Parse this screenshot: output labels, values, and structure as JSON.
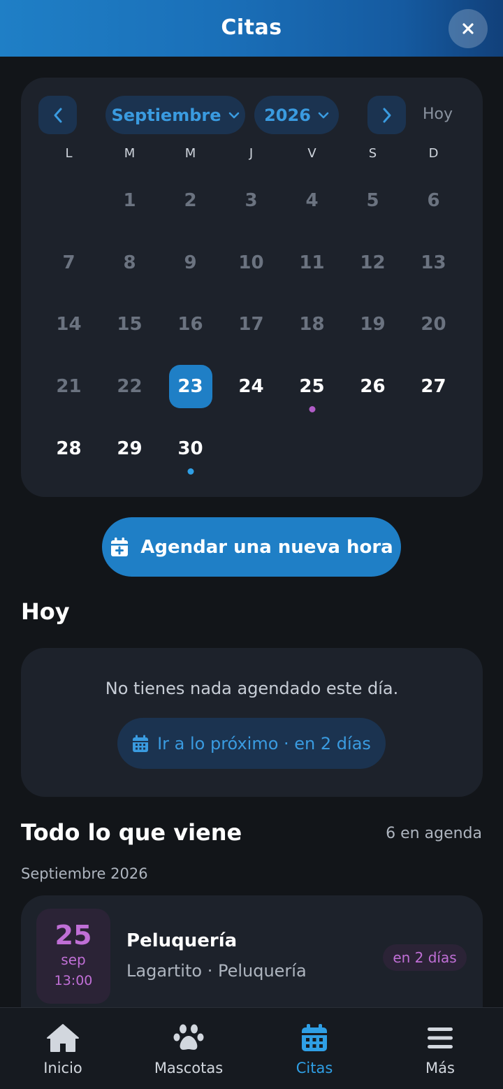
{
  "header": {
    "title": "Citas",
    "close_icon": "close-icon"
  },
  "calendar": {
    "month": "Septiembre",
    "year": "2026",
    "today_label": "Hoy",
    "weekdays": [
      "L",
      "M",
      "M",
      "J",
      "V",
      "S",
      "D"
    ],
    "selected_day": 23,
    "days": [
      {
        "n": "1",
        "state": "past"
      },
      {
        "n": "2",
        "state": "past"
      },
      {
        "n": "3",
        "state": "past"
      },
      {
        "n": "4",
        "state": "past"
      },
      {
        "n": "5",
        "state": "past"
      },
      {
        "n": "6",
        "state": "past"
      },
      {
        "n": "7",
        "state": "past"
      },
      {
        "n": "8",
        "state": "past"
      },
      {
        "n": "9",
        "state": "past"
      },
      {
        "n": "10",
        "state": "past"
      },
      {
        "n": "11",
        "state": "past"
      },
      {
        "n": "12",
        "state": "past"
      },
      {
        "n": "13",
        "state": "past"
      },
      {
        "n": "14",
        "state": "past"
      },
      {
        "n": "15",
        "state": "past"
      },
      {
        "n": "16",
        "state": "past"
      },
      {
        "n": "17",
        "state": "past"
      },
      {
        "n": "18",
        "state": "past"
      },
      {
        "n": "19",
        "state": "past"
      },
      {
        "n": "20",
        "state": "past"
      },
      {
        "n": "21",
        "state": "past"
      },
      {
        "n": "22",
        "state": "past"
      },
      {
        "n": "23",
        "state": "selected"
      },
      {
        "n": "24",
        "state": "future"
      },
      {
        "n": "25",
        "state": "future",
        "dot": "#b05cc7"
      },
      {
        "n": "26",
        "state": "future"
      },
      {
        "n": "27",
        "state": "future"
      },
      {
        "n": "28",
        "state": "future"
      },
      {
        "n": "29",
        "state": "future"
      },
      {
        "n": "30",
        "state": "future",
        "dot": "#2f9fe5"
      }
    ]
  },
  "schedule_button": {
    "label": "Agendar una nueva hora"
  },
  "today_section": {
    "title": "Hoy",
    "empty_text": "No tienes nada agendado este día.",
    "goto_label": "Ir a lo próximo · en 2 días"
  },
  "upcoming": {
    "title": "Todo lo que viene",
    "count": "6 en agenda",
    "month_label": "Septiembre 2026",
    "items": [
      {
        "day": "25",
        "month": "sep",
        "time": "13:00",
        "title": "Peluquería",
        "subtitle": "Lagartito · Peluquería",
        "badge": "en 2 días"
      }
    ]
  },
  "bottom_nav": {
    "items": [
      {
        "label": "Inicio",
        "icon": "home-icon"
      },
      {
        "label": "Mascotas",
        "icon": "paw-icon"
      },
      {
        "label": "Citas",
        "icon": "calendar-icon"
      },
      {
        "label": "Más",
        "icon": "menu-icon"
      }
    ],
    "active": "Citas"
  },
  "colors": {
    "accent": "#1f7fc6",
    "accent_text": "#3a9be0",
    "purple": "#c06fd6",
    "background": "#121519",
    "card": "#1d222b"
  }
}
